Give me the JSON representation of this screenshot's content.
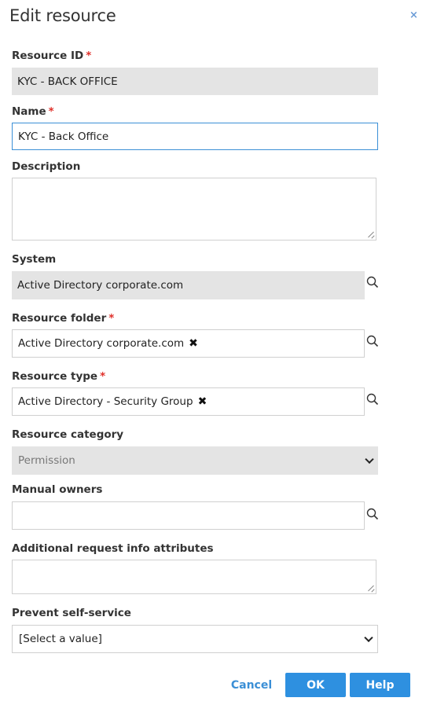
{
  "dialog": {
    "title": "Edit resource",
    "close_glyph": "×"
  },
  "fields": {
    "resource_id": {
      "label": "Resource ID",
      "required_mark": "*",
      "value": "KYC - BACK OFFICE"
    },
    "name": {
      "label": "Name",
      "required_mark": "*",
      "value": "KYC - Back Office"
    },
    "description": {
      "label": "Description",
      "value": ""
    },
    "system": {
      "label": "System",
      "value": "Active Directory corporate.com"
    },
    "resource_folder": {
      "label": "Resource folder",
      "required_mark": "*",
      "value": "Active Directory corporate.com",
      "remove_glyph": "✖"
    },
    "resource_type": {
      "label": "Resource type",
      "required_mark": "*",
      "value": "Active Directory - Security Group",
      "remove_glyph": "✖"
    },
    "resource_category": {
      "label": "Resource category",
      "value": "Permission"
    },
    "manual_owners": {
      "label": "Manual owners",
      "value": ""
    },
    "additional_info": {
      "label": "Additional request info attributes",
      "value": ""
    },
    "prevent_self_service": {
      "label": "Prevent self-service",
      "value": "[Select a value]"
    }
  },
  "actions": {
    "cancel": "Cancel",
    "ok": "OK",
    "help": "Help"
  },
  "colors": {
    "accent": "#2e90e0",
    "required": "#e0302a",
    "readonly_bg": "#e4e4e4",
    "focus_border": "#3b8fd6"
  }
}
